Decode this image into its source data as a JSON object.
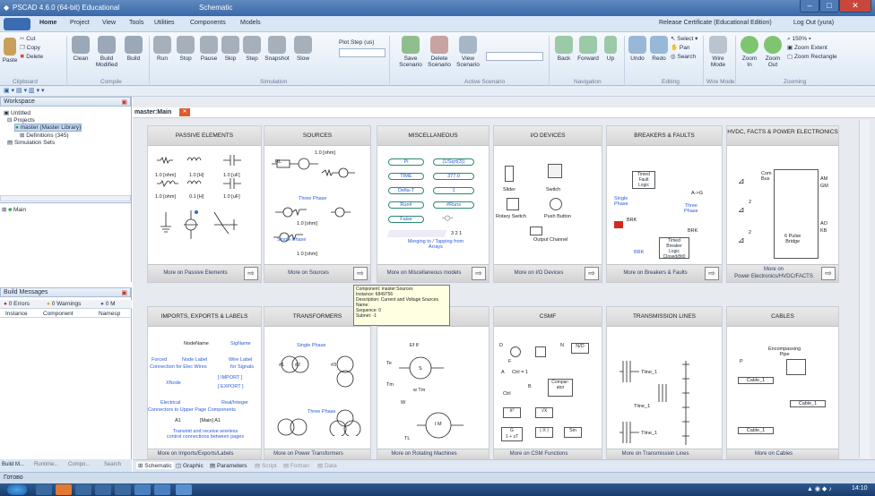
{
  "window": {
    "title": "PSCAD 4.6.0 (64-bit) Educational",
    "context_tab": "Schematic"
  },
  "menu": {
    "items": [
      "Home",
      "Project",
      "View",
      "Tools",
      "Utilities",
      "Components",
      "Models"
    ],
    "right_text": "Release Certificate (Educational Edition)",
    "logout": "Log Out (yura)"
  },
  "ribbon": {
    "clipboard": {
      "cut": "Cut",
      "copy": "Copy",
      "paste": "Paste",
      "delete": "Delete",
      "group": "Clipboard"
    },
    "compile": {
      "clean": "Clean",
      "build_modified": "Build\nModified",
      "build": "Build",
      "group": "Compile"
    },
    "simulation": {
      "run": "Run",
      "stop": "Stop",
      "pause": "Pause",
      "skip": "Skip",
      "step": "Step",
      "snapshot": "Snapshot",
      "slow": "Slow",
      "plot_step": "Plot Step (us)",
      "group": "Simulation"
    },
    "scenario": {
      "save": "Save\nScenario",
      "delete": "Delete\nScenario",
      "view": "View\nScenario",
      "group": "Active Scenario"
    },
    "navigation": {
      "back": "Back",
      "forward": "Forward",
      "up": "Up",
      "group": "Navigation"
    },
    "editing": {
      "undo": "Undo",
      "redo": "Redo",
      "select": "Select",
      "pan": "Pan",
      "search": "Search",
      "group": "Editing"
    },
    "wiremode": {
      "label": "Wire\nMode",
      "group": "Wire Mode"
    },
    "zooming": {
      "zoom_in": "Zoom\nIn",
      "zoom_out": "Zoom\nOut",
      "zoom_level": "150%",
      "zoom_extent": "Zoom Extent",
      "zoom_rect": "Zoom Rectangle",
      "group": "Zooming"
    }
  },
  "workspace": {
    "title": "Workspace",
    "items": [
      "Untitled",
      "Projects",
      "master (Master Library)",
      "Definitions (345)",
      "Simulation Sets"
    ],
    "main": "Main"
  },
  "build": {
    "title": "Build Messages",
    "errors": "0 Errors",
    "warnings": "0 Warnings",
    "messages": "0 M",
    "cols": [
      "Instance",
      "Component",
      "Namesp"
    ]
  },
  "bottom_tabs": [
    "Build M...",
    "Runtime...",
    "Compo...",
    "Search"
  ],
  "doc": {
    "tab": "master:Main"
  },
  "cards": [
    {
      "title": "PASSIVE ELEMENTS",
      "footer": "More on Passive Elements"
    },
    {
      "title": "SOURCES",
      "footer": "More on Sources"
    },
    {
      "title": "MISCELLANEOUS",
      "footer": "More on Miscellaneous models"
    },
    {
      "title": "I/O DEVICES",
      "footer": "More on I/O Devices"
    },
    {
      "title": "BREAKERS & FAULTS",
      "footer": "More on Breakers & Faults"
    },
    {
      "title": "HVDC, FACTS & POWER ELECTRONICS",
      "footer": "More on\nPower Electronics/HVDC/FACTS"
    },
    {
      "title": "IMPORTS, EXPORTS & LABELS",
      "footer": "More on Imports/Exports/Labels"
    },
    {
      "title": "TRANSFORMERS",
      "footer": "More on Power Transformers"
    },
    {
      "title": "",
      "footer": "More on Rotating Machines"
    },
    {
      "title": "CSMF",
      "footer": "More on CSM Functions"
    },
    {
      "title": "TRANSMISSION LINES",
      "footer": "More on Transmission Lines"
    },
    {
      "title": "CABLES",
      "footer": "More on Cables"
    }
  ],
  "passive": {
    "r": "1.0 [ohm]",
    "l": "1.0 [H]",
    "c": "1.0 [uF]",
    "rl": "1.0 [ohm]",
    "l2": "0.1 [H]",
    "c2": "1.0 [uF]"
  },
  "sources": {
    "rl": "RL",
    "v": "1.0 [ohm]",
    "three": "Three Phase",
    "single": "Single Phase",
    "r1": "1.0 [ohm]",
    "r2": "1.0 [ohm]"
  },
  "misc": {
    "pi": "Pi",
    "sqrt": "(1/Sqrt(3))",
    "time": "TIME",
    "val": "377.0",
    "delta": "Delta-T",
    "one": "1",
    "run": "Run#",
    "nruns": "#Runs",
    "false": "False",
    "note": "Merging to / Tapping from\nArrays",
    "n": "3  2  1"
  },
  "io": {
    "slider": "Slider",
    "switch": "Switch",
    "rotary": "Rotary Switch",
    "push": "Push Button",
    "output": "Output Channel"
  },
  "breakers": {
    "timed_fault": "Timed\nFault\nLogic",
    "ag": "A->G",
    "single": "Single\nPhase",
    "three": "Three\nPhase",
    "brk1": "BRK",
    "brk2": "BRK",
    "brk3": "BRK",
    "timed_brk": "Timed\nBreaker\nLogic\nClosed@t0"
  },
  "hvdc": {
    "com": "Com\nBus",
    "am": "AM",
    "gm": "GM",
    "ao": "AO",
    "kb": "KB",
    "pulse": "6 Pulse\nBridge",
    "n1": "2",
    "n2": "2"
  },
  "imports": {
    "nodename": "NodeName",
    "signame": "SigName",
    "forced": "Forced",
    "node_label": "Node Label",
    "wire_label": "Wire Label",
    "conn_elec": "Connection for Elec Wires",
    "for_signals": "for Signals",
    "xnode": "XNode",
    "import": "[ IMPORT ]",
    "export": "[ EXPORT ]",
    "electrical": "Electrical",
    "realint": "Real/Integer",
    "upper": "Connectors to Upper Page Components",
    "a1": "A1",
    "main": "[Main] A1",
    "transmit": "Transmit and receive wireless\ncontrol connections between pages"
  },
  "trafo": {
    "single": "Single Phase",
    "three": "Three Phase",
    "n1": "#1",
    "n2": "#2",
    "n3": "#3"
  },
  "rotating": {
    "ef": "Ef  If",
    "te": "Te",
    "tm": "Tm",
    "s": "S",
    "w": "W",
    "tm2": "w  Tm",
    "tl": "TL",
    "im": "I M"
  },
  "csmf": {
    "d": "D",
    "f": "F",
    "n": "N",
    "nd": "N/D",
    "a": "A",
    "b": "B",
    "ctrl": "Ctrl = 1",
    "ctrl2": "Ctrl",
    "comp": "Compar-\nator",
    "x2": "x²",
    "sqrtx": "√x",
    "g": "G\n1 + sT",
    "absx": "| X |",
    "sin": "Sin"
  },
  "tlines": {
    "t1": "Tline_1",
    "t2": "Tline_1",
    "t3": "Tline_1"
  },
  "cables": {
    "enc": "Encompassing\nPipe",
    "p": "P",
    "c1": "Cable_1",
    "c2": "Cable_1",
    "c3": "Cable_1"
  },
  "tooltip": {
    "lines": [
      "Component: master:Sources",
      "Instance: 6849756",
      "Description: Current and Voltage Sources",
      "Name:",
      "Sequence: 0",
      "Subnet: -1"
    ]
  },
  "doc_tabs": [
    "Schematic",
    "Graphic",
    "Parameters",
    "Script",
    "Fortran",
    "Data"
  ],
  "status": "Готово",
  "clock": "14:10"
}
